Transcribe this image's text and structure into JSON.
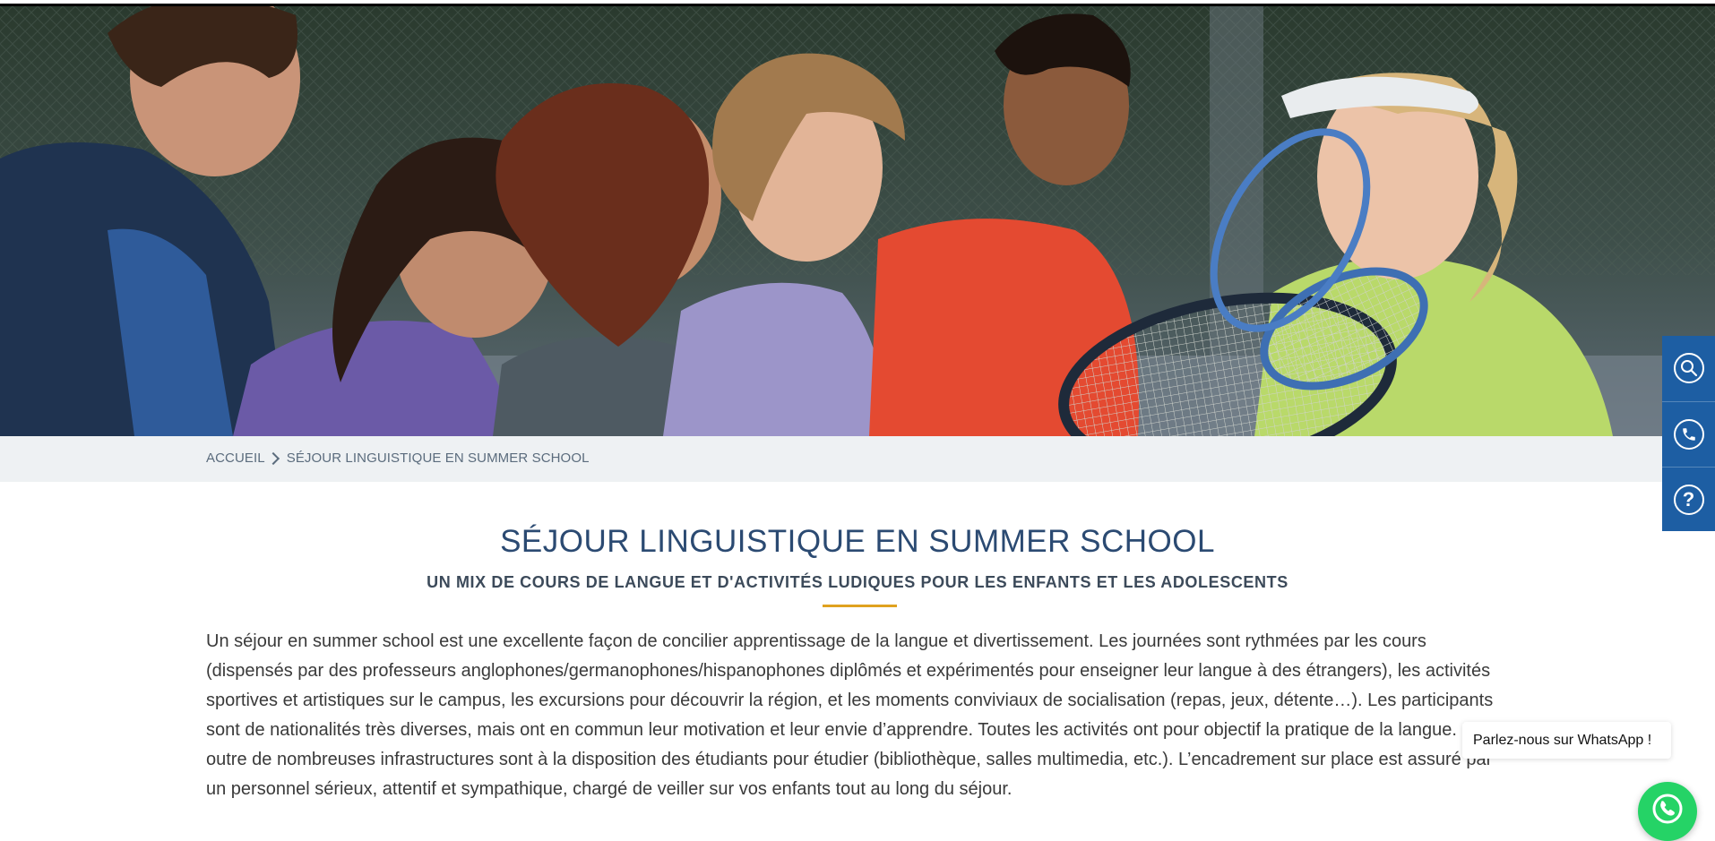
{
  "breadcrumb": {
    "home": "ACCUEIL",
    "current": "SÉJOUR LINGUISTIQUE EN SUMMER SCHOOL"
  },
  "main": {
    "title": "SÉJOUR LINGUISTIQUE EN SUMMER SCHOOL",
    "subtitle": "UN MIX DE COURS DE LANGUE ET D'ACTIVITÉS LUDIQUES POUR LES ENFANTS ET LES ADOLESCENTS",
    "paragraph": "Un séjour en summer school est une excellente façon de concilier apprentissage de la langue et divertissement. Les journées sont rythmées par les cours (dispensés par des professeurs anglophones/germanophones/hispanophones diplômés et expérimentés pour enseigner leur langue à des étrangers), les activités sportives et artistiques sur le campus, les excursions pour découvrir la région, et les moments conviviaux de socialisation (repas, jeux, détente…). Les participants sont de nationalités très diverses, mais ont en commun leur motivation et leur envie d’apprendre. Toutes les activités ont pour objectif la pratique de la langue. En outre de nombreuses infrastructures sont à la disposition des étudiants pour étudier (bibliothèque, salles multimedia, etc.). L’encadrement sur place est assuré par un personnel sérieux, attentif et sympathique, chargé de veiller sur vos enfants tout au long du séjour."
  },
  "side_toolbar": {
    "icons": [
      "search-icon",
      "phone-icon",
      "help-icon"
    ],
    "help_glyph": "?"
  },
  "whatsapp": {
    "bubble_text": "Parlez-nous sur WhatsApp !",
    "icon": "whatsapp-icon"
  },
  "colors": {
    "title": "#2b4a72",
    "accent_rule": "#e0a21f",
    "toolbar": "#1d5ea3",
    "whatsapp": "#25d366",
    "breadcrumb_bg": "#eef1f3"
  }
}
